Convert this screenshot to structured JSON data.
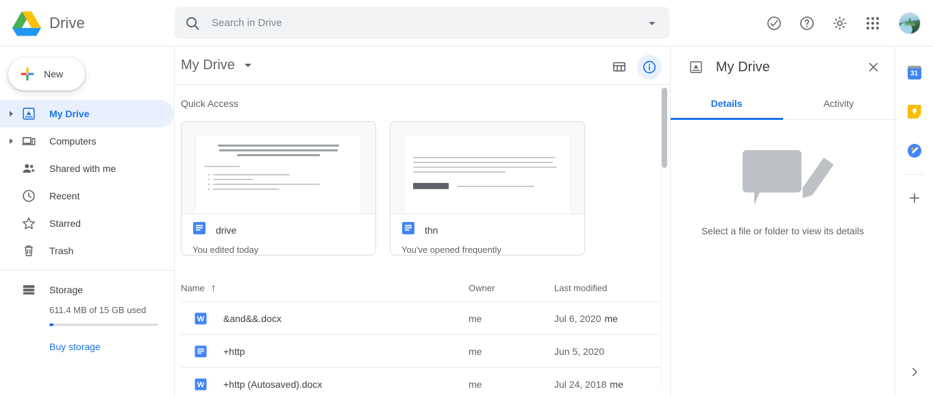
{
  "topbar": {
    "product_name": "Drive",
    "logo_icon": "google-drive-logo",
    "search": {
      "placeholder": "Search in Drive",
      "value": "",
      "icon": "search-icon",
      "options_icon": "chevron-down-icon"
    },
    "icons": [
      {
        "name": "support-icon",
        "label": "Support"
      },
      {
        "name": "help-icon",
        "label": "Help"
      },
      {
        "name": "settings-gear-icon",
        "label": "Settings"
      },
      {
        "name": "google-apps-grid-icon",
        "label": "Google apps"
      }
    ],
    "avatar": {
      "name": "user-avatar",
      "label": "Account"
    }
  },
  "sidebar": {
    "new_button": {
      "label": "New",
      "icon": "plus-icon"
    },
    "items": [
      {
        "label": "My Drive",
        "icon": "my-drive-icon",
        "expandable": true,
        "active": true
      },
      {
        "label": "Computers",
        "icon": "computers-icon",
        "expandable": true,
        "active": false
      },
      {
        "label": "Shared with me",
        "icon": "shared-with-me-icon",
        "expandable": false,
        "active": false
      },
      {
        "label": "Recent",
        "icon": "clock-icon",
        "expandable": false,
        "active": false
      },
      {
        "label": "Starred",
        "icon": "star-icon",
        "expandable": false,
        "active": false
      },
      {
        "label": "Trash",
        "icon": "trash-icon",
        "expandable": false,
        "active": false
      }
    ],
    "storage": {
      "label": "Storage",
      "icon": "storage-icon",
      "usage_text": "611.4 MB of 15 GB used",
      "used_percent": 4,
      "buy_link": "Buy storage",
      "accent_color": "#1a73e8"
    }
  },
  "main": {
    "title": "My Drive",
    "title_caret_icon": "chevron-down-icon",
    "view_toggle_icon": "grid-view-icon",
    "details_toggle_icon": "info-circle-icon",
    "quick_access": {
      "heading": "Quick Access",
      "cards": [
        {
          "name": "drive",
          "subtitle": "You edited today",
          "file_icon": "google-docs-icon",
          "thumb_title": "Ревю на услугата за съхранение и синхронизиране на файлове Google Drive, текстовия процесор Google Docs и приложението за настолни компютри Backup and Sync",
          "thumb_sub": "Предимства:",
          "thumb_bullets": [
            "15 GB безплатен капацитет за съхранение",
            "Лесен за използване",
            "Достъпност от всички устройства по всяко време, включително и офлайн"
          ]
        },
        {
          "name": "thn",
          "subtitle": "You've opened frequently",
          "file_icon": "google-docs-icon",
          "thumb_paragraph": "Участвам в състезание с наградния фонд, в което класирането се базира на одобрения от нерегистрирани потребители. Моите благодарности, ако ме подкрепите като кликнете на следващите линкове. Името им на сайта е бутв. Под всяка публикация в ляво има бутон \"Благодаря\" или \"thanks\", който изглежда така:",
          "thumb_button": "Благодаря",
          "thumb_note": "Просто кликнете върху него. И аз ви благодаря!"
        }
      ]
    },
    "table": {
      "columns": [
        {
          "label": "Name",
          "sort_icon": "arrow-up-icon",
          "sorted": true
        },
        {
          "label": "Owner",
          "sort_icon": "",
          "sorted": false
        },
        {
          "label": "Last modified",
          "sort_icon": "",
          "sorted": false
        }
      ],
      "rows": [
        {
          "name": "&and&&.docx",
          "icon": "word-doc-icon",
          "owner": "me",
          "modified": "Jul 6, 2020",
          "modified_by": "me"
        },
        {
          "name": "+http",
          "icon": "google-docs-icon",
          "owner": "me",
          "modified": "Jun 5, 2020",
          "modified_by": ""
        },
        {
          "name": "+http (Autosaved).docx",
          "icon": "word-doc-icon",
          "owner": "me",
          "modified": "Jul 24, 2018",
          "modified_by": "me"
        }
      ]
    }
  },
  "details_panel": {
    "title": "My Drive",
    "icon": "my-drive-icon",
    "close_icon": "close-icon",
    "tabs": [
      {
        "label": "Details",
        "active": true
      },
      {
        "label": "Activity",
        "active": false
      }
    ],
    "empty_state": {
      "illustration": "speech-bubble-pencil-illustration",
      "text": "Select a file or folder to view its details"
    }
  },
  "right_rail": {
    "apps": [
      {
        "name": "google-calendar-icon",
        "label": "Calendar",
        "badge": "31"
      },
      {
        "name": "google-keep-icon",
        "label": "Keep"
      },
      {
        "name": "google-tasks-icon",
        "label": "Tasks"
      }
    ],
    "add_button": {
      "name": "add-on-plus-icon",
      "label": "+"
    },
    "expand_button": {
      "name": "chevron-right-icon",
      "label": "Show side panel"
    }
  }
}
